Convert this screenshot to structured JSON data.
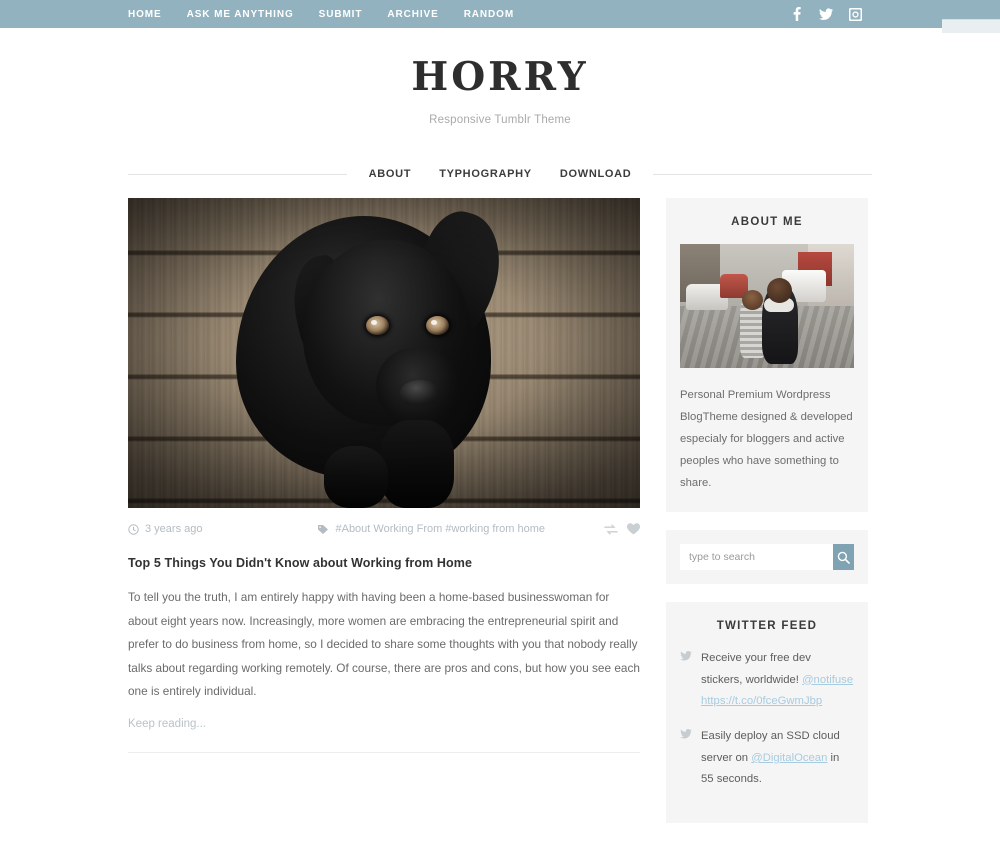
{
  "topnav": {
    "items": [
      {
        "label": "HOME"
      },
      {
        "label": "ASK ME ANYTHING"
      },
      {
        "label": "SUBMIT"
      },
      {
        "label": "ARCHIVE"
      },
      {
        "label": "RANDOM"
      }
    ],
    "social": [
      {
        "name": "facebook-icon"
      },
      {
        "name": "twitter-icon"
      },
      {
        "name": "instagram-icon"
      }
    ],
    "bg_color": "#92b2bf"
  },
  "header": {
    "logo": "HORRY",
    "tagline": "Responsive Tumblr Theme"
  },
  "submenu": {
    "items": [
      {
        "label": "ABOUT"
      },
      {
        "label": "TYPHOGRAPHY"
      },
      {
        "label": "DOWNLOAD"
      }
    ]
  },
  "post": {
    "photo_alt": "black labrador puppy on weathered wood planks",
    "date": "3 years ago",
    "tags": "#About Working From #working from home",
    "title": "Top 5 Things You Didn't Know about Working from Home",
    "body": "To tell you the truth, I am entirely happy with having been a home-based businesswoman for about eight years now. Increasingly, more women are embracing the entrepreneurial spirit and prefer to do business from home, so I decided to share some thoughts with you that nobody really talks about regarding working remotely. Of course, there are pros and cons, but how you see each one is entirely individual.",
    "keep_reading": "Keep reading..."
  },
  "sidebar": {
    "about": {
      "title": "ABOUT ME",
      "photo_alt": "woman and child crouching on a cobblestone street",
      "text": "Personal Premium Wordpress BlogTheme designed & developed especialy for bloggers and active peoples who have something to share."
    },
    "search": {
      "placeholder": "type to search",
      "value": "",
      "button_color": "#7fa3b3"
    },
    "twitter": {
      "title": "TWITTER FEED",
      "tweets": [
        {
          "text_1": "Receive your free dev stickers, worldwide! ",
          "mention": "@notifuse",
          "text_2": " ",
          "url": "https://t.co/0fceGwmJbp"
        },
        {
          "text_1": "Easily deploy an SSD cloud server on ",
          "mention": "@DigitalOcean",
          "text_2": " in 55 seconds.",
          "url": ""
        }
      ]
    }
  }
}
